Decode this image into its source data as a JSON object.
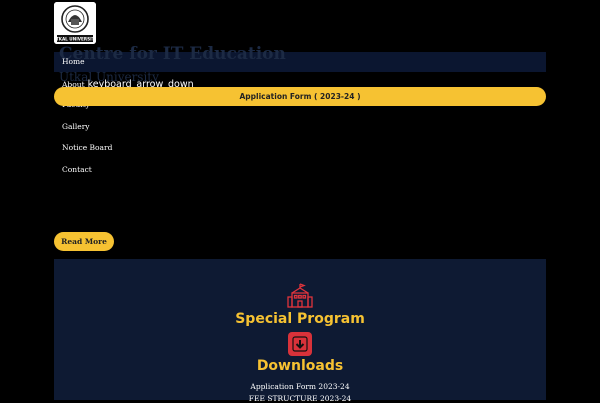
{
  "header": {
    "logo_text": "UTKAL UNIVERSITY",
    "site_title": "Centre for IT Education",
    "site_subtitle": "Utkal University"
  },
  "nav": {
    "items": [
      {
        "label": "Home"
      },
      {
        "label": "About",
        "toggle": "keyboard_arrow_down"
      },
      {
        "label": "Faculty"
      },
      {
        "label": "Gallery"
      },
      {
        "label": "Notice Board"
      },
      {
        "label": "Contact"
      }
    ]
  },
  "banner": {
    "label": "Application Form ( 2023-24 )"
  },
  "hero": {
    "read_more_label": "Read More"
  },
  "sections": {
    "special_program": {
      "title": "Special Program",
      "icon": "building-icon"
    },
    "downloads": {
      "title": "Downloads",
      "icon": "download-icon",
      "links": [
        "Application Form 2023-24",
        "FEE STRUCTURE 2023-24"
      ]
    }
  },
  "colors": {
    "background": "#000000",
    "navbar": "#0b1630",
    "panel": "#0e1a33",
    "accent": "#f6c232",
    "download_icon": "#d8323a"
  }
}
